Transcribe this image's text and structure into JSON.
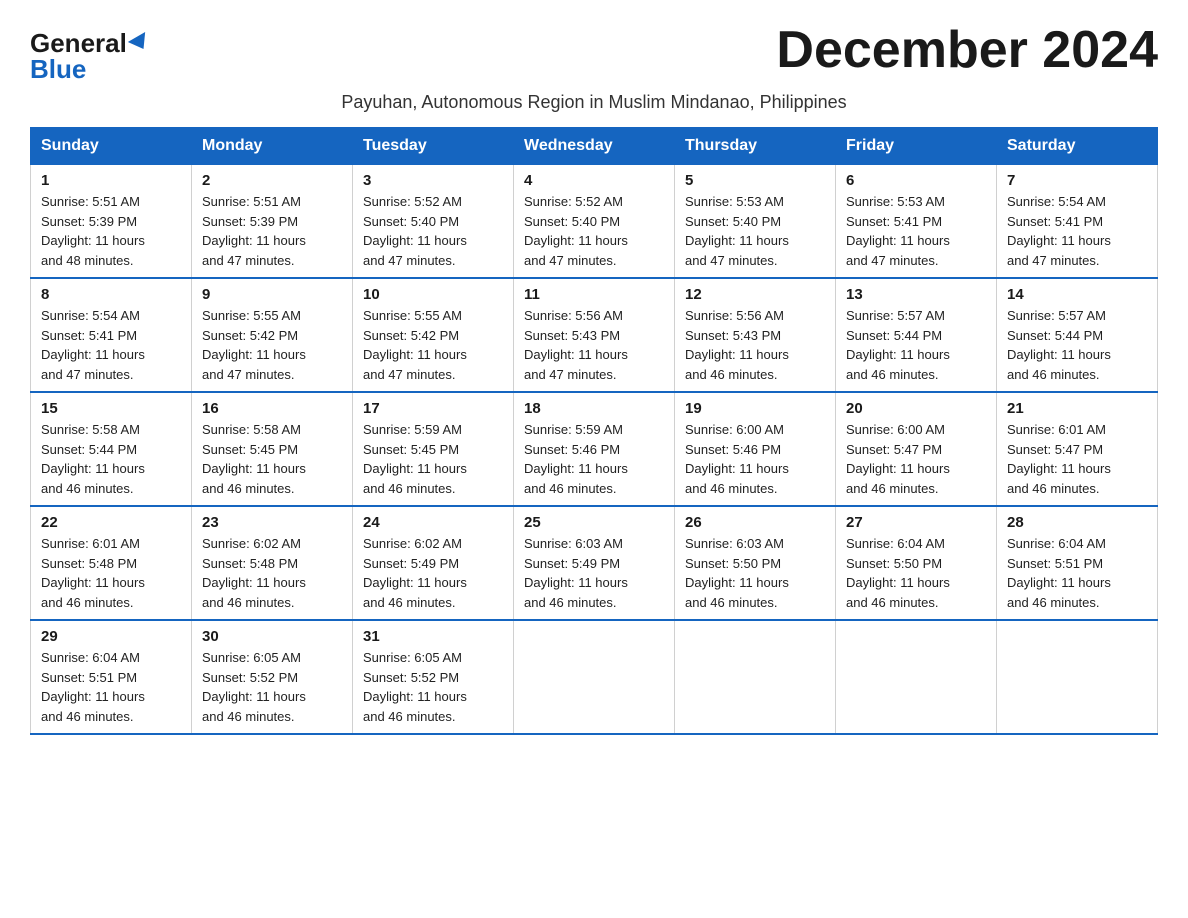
{
  "logo": {
    "general": "General",
    "blue": "Blue"
  },
  "header": {
    "month_title": "December 2024",
    "subtitle": "Payuhan, Autonomous Region in Muslim Mindanao, Philippines"
  },
  "days_of_week": [
    "Sunday",
    "Monday",
    "Tuesday",
    "Wednesday",
    "Thursday",
    "Friday",
    "Saturday"
  ],
  "weeks": [
    [
      {
        "day": "1",
        "sunrise": "5:51 AM",
        "sunset": "5:39 PM",
        "daylight": "11 hours and 48 minutes."
      },
      {
        "day": "2",
        "sunrise": "5:51 AM",
        "sunset": "5:39 PM",
        "daylight": "11 hours and 47 minutes."
      },
      {
        "day": "3",
        "sunrise": "5:52 AM",
        "sunset": "5:40 PM",
        "daylight": "11 hours and 47 minutes."
      },
      {
        "day": "4",
        "sunrise": "5:52 AM",
        "sunset": "5:40 PM",
        "daylight": "11 hours and 47 minutes."
      },
      {
        "day": "5",
        "sunrise": "5:53 AM",
        "sunset": "5:40 PM",
        "daylight": "11 hours and 47 minutes."
      },
      {
        "day": "6",
        "sunrise": "5:53 AM",
        "sunset": "5:41 PM",
        "daylight": "11 hours and 47 minutes."
      },
      {
        "day": "7",
        "sunrise": "5:54 AM",
        "sunset": "5:41 PM",
        "daylight": "11 hours and 47 minutes."
      }
    ],
    [
      {
        "day": "8",
        "sunrise": "5:54 AM",
        "sunset": "5:41 PM",
        "daylight": "11 hours and 47 minutes."
      },
      {
        "day": "9",
        "sunrise": "5:55 AM",
        "sunset": "5:42 PM",
        "daylight": "11 hours and 47 minutes."
      },
      {
        "day": "10",
        "sunrise": "5:55 AM",
        "sunset": "5:42 PM",
        "daylight": "11 hours and 47 minutes."
      },
      {
        "day": "11",
        "sunrise": "5:56 AM",
        "sunset": "5:43 PM",
        "daylight": "11 hours and 47 minutes."
      },
      {
        "day": "12",
        "sunrise": "5:56 AM",
        "sunset": "5:43 PM",
        "daylight": "11 hours and 46 minutes."
      },
      {
        "day": "13",
        "sunrise": "5:57 AM",
        "sunset": "5:44 PM",
        "daylight": "11 hours and 46 minutes."
      },
      {
        "day": "14",
        "sunrise": "5:57 AM",
        "sunset": "5:44 PM",
        "daylight": "11 hours and 46 minutes."
      }
    ],
    [
      {
        "day": "15",
        "sunrise": "5:58 AM",
        "sunset": "5:44 PM",
        "daylight": "11 hours and 46 minutes."
      },
      {
        "day": "16",
        "sunrise": "5:58 AM",
        "sunset": "5:45 PM",
        "daylight": "11 hours and 46 minutes."
      },
      {
        "day": "17",
        "sunrise": "5:59 AM",
        "sunset": "5:45 PM",
        "daylight": "11 hours and 46 minutes."
      },
      {
        "day": "18",
        "sunrise": "5:59 AM",
        "sunset": "5:46 PM",
        "daylight": "11 hours and 46 minutes."
      },
      {
        "day": "19",
        "sunrise": "6:00 AM",
        "sunset": "5:46 PM",
        "daylight": "11 hours and 46 minutes."
      },
      {
        "day": "20",
        "sunrise": "6:00 AM",
        "sunset": "5:47 PM",
        "daylight": "11 hours and 46 minutes."
      },
      {
        "day": "21",
        "sunrise": "6:01 AM",
        "sunset": "5:47 PM",
        "daylight": "11 hours and 46 minutes."
      }
    ],
    [
      {
        "day": "22",
        "sunrise": "6:01 AM",
        "sunset": "5:48 PM",
        "daylight": "11 hours and 46 minutes."
      },
      {
        "day": "23",
        "sunrise": "6:02 AM",
        "sunset": "5:48 PM",
        "daylight": "11 hours and 46 minutes."
      },
      {
        "day": "24",
        "sunrise": "6:02 AM",
        "sunset": "5:49 PM",
        "daylight": "11 hours and 46 minutes."
      },
      {
        "day": "25",
        "sunrise": "6:03 AM",
        "sunset": "5:49 PM",
        "daylight": "11 hours and 46 minutes."
      },
      {
        "day": "26",
        "sunrise": "6:03 AM",
        "sunset": "5:50 PM",
        "daylight": "11 hours and 46 minutes."
      },
      {
        "day": "27",
        "sunrise": "6:04 AM",
        "sunset": "5:50 PM",
        "daylight": "11 hours and 46 minutes."
      },
      {
        "day": "28",
        "sunrise": "6:04 AM",
        "sunset": "5:51 PM",
        "daylight": "11 hours and 46 minutes."
      }
    ],
    [
      {
        "day": "29",
        "sunrise": "6:04 AM",
        "sunset": "5:51 PM",
        "daylight": "11 hours and 46 minutes."
      },
      {
        "day": "30",
        "sunrise": "6:05 AM",
        "sunset": "5:52 PM",
        "daylight": "11 hours and 46 minutes."
      },
      {
        "day": "31",
        "sunrise": "6:05 AM",
        "sunset": "5:52 PM",
        "daylight": "11 hours and 46 minutes."
      },
      null,
      null,
      null,
      null
    ]
  ],
  "labels": {
    "sunrise": "Sunrise:",
    "sunset": "Sunset:",
    "daylight": "Daylight:"
  }
}
